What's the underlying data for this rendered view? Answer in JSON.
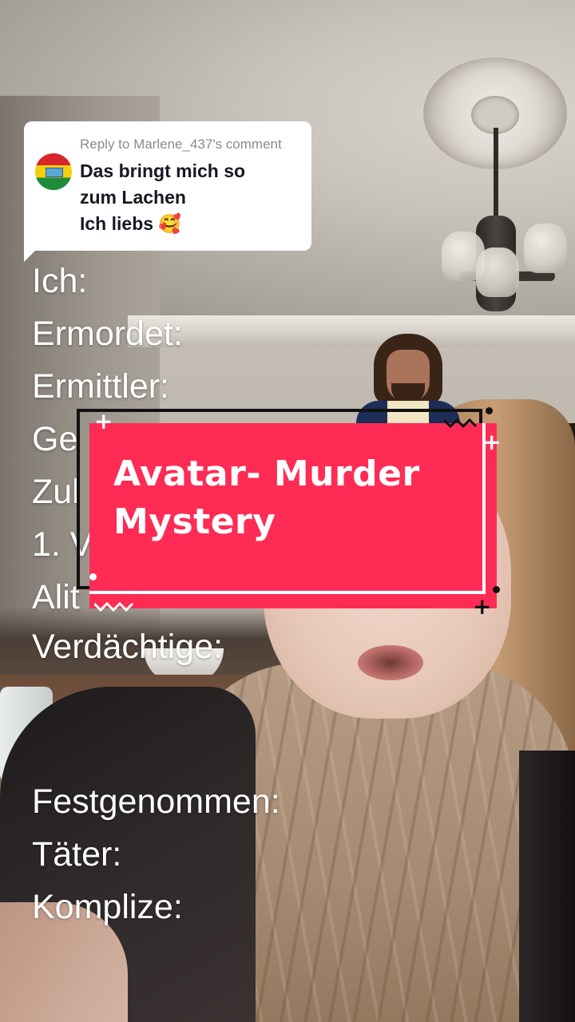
{
  "reply": {
    "header": "Reply to Marlene_437's comment",
    "lines": [
      "Das bringt mich so",
      "zum Lachen",
      "Ich liebs 🥰"
    ]
  },
  "overlay": {
    "lines": [
      "Ich:",
      "Ermordet:",
      "Ermittler:",
      "Ge",
      "Zul",
      "1. V",
      "Alit",
      "Verdächtige:",
      "Festgenommen:",
      "Täter:",
      "Komplize:"
    ]
  },
  "banner": {
    "line1": "Avatar- Murder",
    "line2": "Mystery"
  },
  "colors": {
    "banner": "#fe2c55",
    "bubble": "#ffffff",
    "reply_header": "#8a8b91",
    "reply_text": "#161823",
    "overlay_text": "#ffffff"
  }
}
